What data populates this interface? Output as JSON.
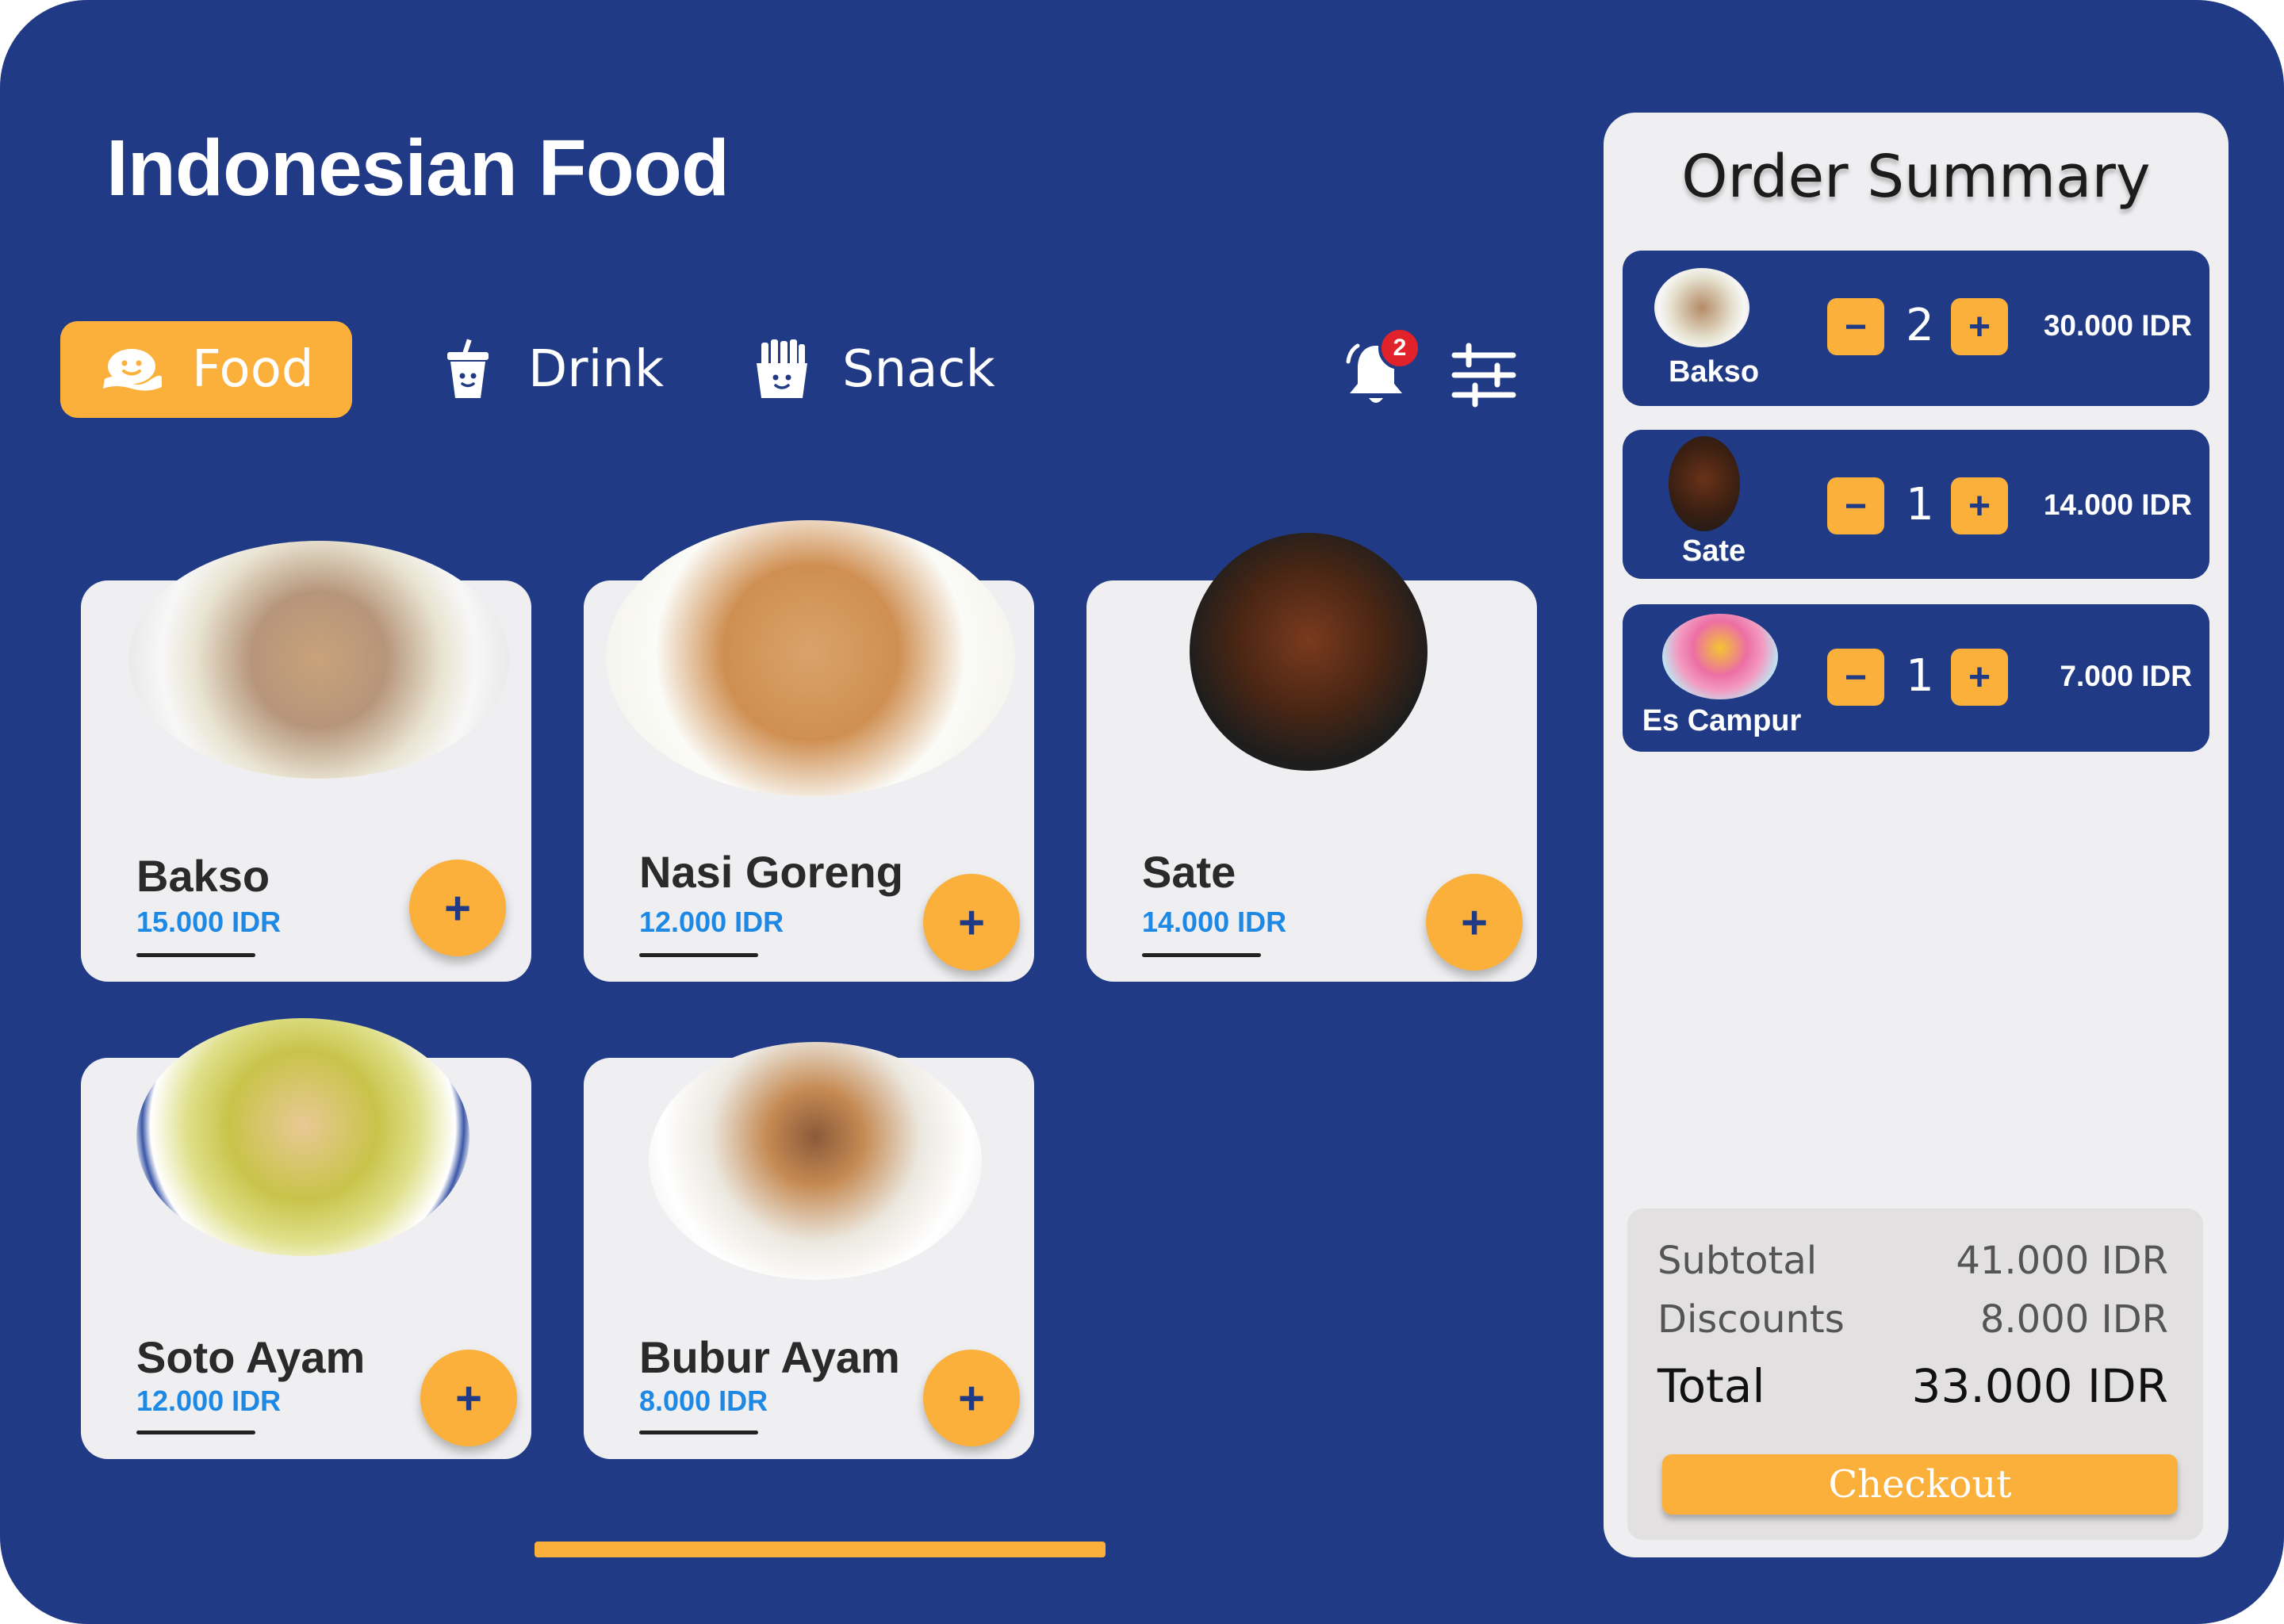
{
  "header": {
    "title": "Indonesian Food"
  },
  "tabs": [
    {
      "label": "Food",
      "icon": "food-icon",
      "active": true
    },
    {
      "label": "Drink",
      "icon": "drink-icon",
      "active": false
    },
    {
      "label": "Snack",
      "icon": "snack-icon",
      "active": false
    }
  ],
  "toolbar": {
    "notification_count": "2",
    "notification_icon": "bell-icon",
    "filter_icon": "sliders-icon"
  },
  "products": [
    {
      "name": "Bakso",
      "price": "15.000 IDR",
      "add_label": "+"
    },
    {
      "name": "Nasi Goreng",
      "price": "12.000 IDR",
      "add_label": "+"
    },
    {
      "name": "Sate",
      "price": "14.000 IDR",
      "add_label": "+"
    },
    {
      "name": "Soto Ayam",
      "price": "12.000 IDR",
      "add_label": "+"
    },
    {
      "name": "Bubur Ayam",
      "price": "8.000 IDR",
      "add_label": "+"
    }
  ],
  "summary": {
    "title": "Order Summary",
    "items": [
      {
        "name": "Bakso",
        "qty": "2",
        "price": "30.000 IDR",
        "minus": "−",
        "plus": "+"
      },
      {
        "name": "Sate",
        "qty": "1",
        "price": "14.000 IDR",
        "minus": "−",
        "plus": "+"
      },
      {
        "name": "Es Campur",
        "qty": "1",
        "price": "7.000 IDR",
        "minus": "−",
        "plus": "+"
      }
    ],
    "subtotal_label": "Subtotal",
    "subtotal_value": "41.000 IDR",
    "discounts_label": "Discounts",
    "discounts_value": "8.000 IDR",
    "total_label": "Total",
    "total_value": "33.000 IDR",
    "checkout_label": "Checkout"
  },
  "colors": {
    "background": "#203a86",
    "accent": "#fbb03b",
    "card": "#efeff1",
    "price": "#1e88e5",
    "badge": "#e2222a"
  }
}
